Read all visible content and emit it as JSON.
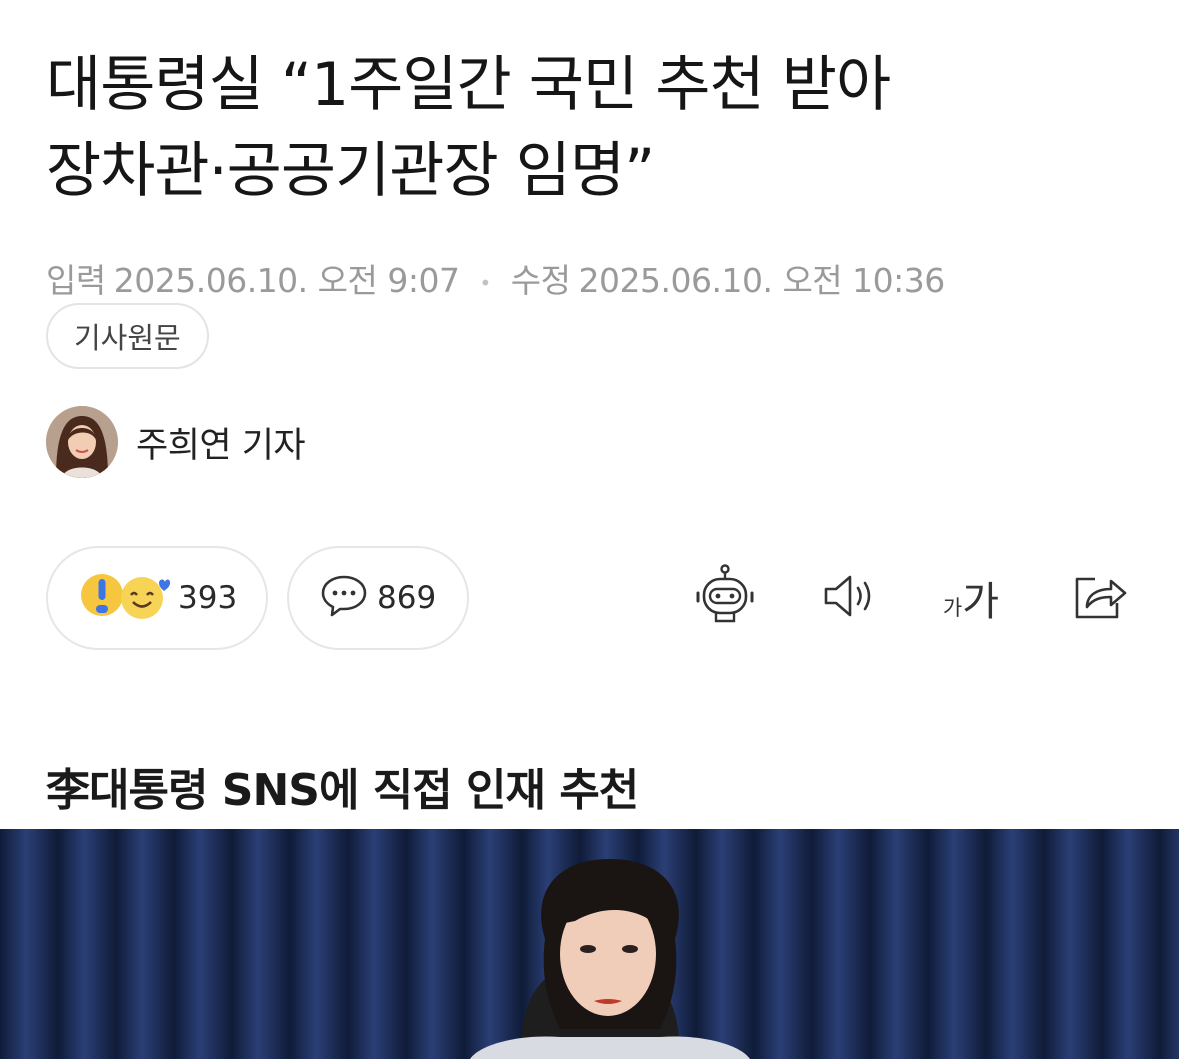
{
  "article": {
    "title_line1": "대통령실 “1주일간 국민 추천 받아",
    "title_line2": "장차관·공공기관장 임명”",
    "input_label": "입력",
    "input_date": "2025.06.10. 오전 9:07",
    "separator": "•",
    "modified_label": "수정",
    "modified_date": "2025.06.10. 오전 10:36",
    "original_link": "기사원문",
    "author": "주희연 기자",
    "subheading": "李대통령 SNS에 직접 인재 추천"
  },
  "engagement": {
    "reaction_count": "393",
    "comment_count": "869"
  },
  "toolbar": {
    "font_small": "가",
    "font_large": "가"
  },
  "icons": [
    "surprise-emoji-icon",
    "smile-emoji-icon",
    "comment-icon",
    "robot-summary-icon",
    "speaker-icon",
    "font-size-icon",
    "share-icon"
  ],
  "colors": {
    "title": "#161616",
    "meta": "#9a9a9a",
    "border": "#e4e4e4",
    "emoji_yellow": "#f6c63f",
    "emoji_blue": "#3d74e6",
    "curtain": "#1b2c55"
  }
}
